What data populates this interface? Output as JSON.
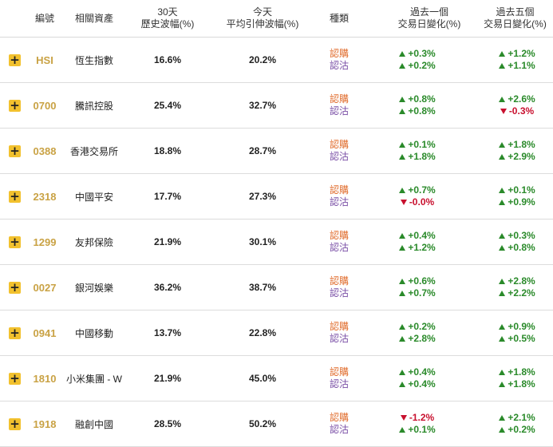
{
  "header": {
    "code": "編號",
    "asset": "相關資產",
    "vol30_line1": "30天",
    "vol30_line2": "歷史波幅(%)",
    "ivol_line1": "今天",
    "ivol_line2": "平均引伸波幅(%)",
    "kind": "種類",
    "chg1_line1": "過去一個",
    "chg1_line2": "交易日變化(%)",
    "chg5_line1": "過去五個",
    "chg5_line2": "交易日變化(%)"
  },
  "plus_glyph": "+",
  "kind_call": "認購",
  "kind_put": "認沽",
  "colors": {
    "accent": "#f2c12e",
    "code": "#c9a244",
    "call": "#e06c2c",
    "put": "#7a4fa6",
    "up": "#2a8a2a",
    "down": "#c8102e"
  },
  "rows": [
    {
      "code": "HSI",
      "asset": "恆生指數",
      "vol30": "16.6%",
      "ivol": "20.2%",
      "c1": "+0.3%",
      "p1": "+0.2%",
      "c5": "+1.2%",
      "p5": "+1.1%"
    },
    {
      "code": "0700",
      "asset": "騰訊控股",
      "vol30": "25.4%",
      "ivol": "32.7%",
      "c1": "+0.8%",
      "p1": "+0.8%",
      "c5": "+2.6%",
      "p5": "-0.3%"
    },
    {
      "code": "0388",
      "asset": "香港交易所",
      "vol30": "18.8%",
      "ivol": "28.7%",
      "c1": "+0.1%",
      "p1": "+1.8%",
      "c5": "+1.8%",
      "p5": "+2.9%"
    },
    {
      "code": "2318",
      "asset": "中國平安",
      "vol30": "17.7%",
      "ivol": "27.3%",
      "c1": "+0.7%",
      "p1": "-0.0%",
      "c5": "+0.1%",
      "p5": "+0.9%"
    },
    {
      "code": "1299",
      "asset": "友邦保險",
      "vol30": "21.9%",
      "ivol": "30.1%",
      "c1": "+0.4%",
      "p1": "+1.2%",
      "c5": "+0.3%",
      "p5": "+0.8%"
    },
    {
      "code": "0027",
      "asset": "銀河娛樂",
      "vol30": "36.2%",
      "ivol": "38.7%",
      "c1": "+0.6%",
      "p1": "+0.7%",
      "c5": "+2.8%",
      "p5": "+2.2%"
    },
    {
      "code": "0941",
      "asset": "中國移動",
      "vol30": "13.7%",
      "ivol": "22.8%",
      "c1": "+0.2%",
      "p1": "+2.8%",
      "c5": "+0.9%",
      "p5": "+0.5%"
    },
    {
      "code": "1810",
      "asset": "小米集團 - W",
      "vol30": "21.9%",
      "ivol": "45.0%",
      "c1": "+0.4%",
      "p1": "+0.4%",
      "c5": "+1.8%",
      "p5": "+1.8%"
    },
    {
      "code": "1918",
      "asset": "融創中國",
      "vol30": "28.5%",
      "ivol": "50.2%",
      "c1": "-1.2%",
      "p1": "+0.1%",
      "c5": "+2.1%",
      "p5": "+0.2%"
    }
  ]
}
